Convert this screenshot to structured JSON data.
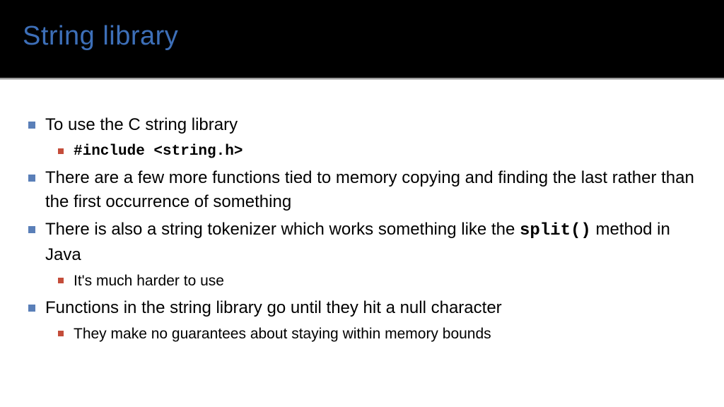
{
  "title": "String library",
  "bullets": [
    {
      "text": "To use the C string library",
      "sub": [
        {
          "code": true,
          "text": "#include <string.h>"
        }
      ]
    },
    {
      "text": "There are a few more functions tied to memory copying and finding the last rather than the first occurrence of something"
    },
    {
      "prefix": "There is also a string tokenizer which works something like the ",
      "code": "split()",
      "suffix": " method in Java",
      "sub": [
        {
          "text": "It's much harder to use"
        }
      ]
    },
    {
      "text": "Functions in the string library go until they hit a null character",
      "sub": [
        {
          "text": "They make no guarantees about staying within memory bounds"
        }
      ]
    }
  ]
}
